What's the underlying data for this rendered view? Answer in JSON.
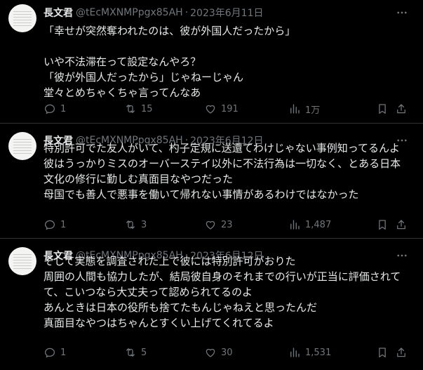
{
  "colors": {
    "background": "#000000",
    "text_primary": "#e7e9ea",
    "text_secondary": "#71767b",
    "divider": "#2f3336"
  },
  "icons": {
    "more": "more-horizontal-icon",
    "reply": "reply-icon",
    "retweet": "retweet-icon",
    "like": "heart-icon",
    "views": "views-chart-icon",
    "bookmark": "bookmark-icon",
    "share": "share-icon"
  },
  "tweets": [
    {
      "name": "長文君",
      "handle": "@tEcMXNMPpgx85AH",
      "separator": "·",
      "date": "2023年6月11日",
      "lines": [
        "「幸せが突然奪われたのは、彼が外国人だったから」",
        "",
        "いや不法滞在って設定なんやろ？",
        "「彼が外国人だったから」じゃねーじゃん",
        "堂々とめちゃくちゃ言ってんなあ"
      ],
      "replies": "1",
      "retweets": "15",
      "likes": "191",
      "views": "1万"
    },
    {
      "name": "長文君",
      "handle": "@tEcMXNMPpgx85AH",
      "separator": "·",
      "date": "2023年6月12日",
      "lines": [
        "特別許可でた友人がいて、杓子定規に送還てわけじゃない事例知ってるんよ",
        "彼はうっかりミスのオーバーステイ以外に不法行為は一切なく、とある日本",
        "文化の修行に勤しむ真面目なやつだった",
        "母国でも善人で悪事を働いて帰れない事情があるわけではなかった"
      ],
      "replies": "1",
      "retweets": "3",
      "likes": "23",
      "views": "1,487"
    },
    {
      "name": "長文君",
      "handle": "@tEcMXNMPpgx85AH",
      "separator": "·",
      "date": "2023年6月12日",
      "lines": [
        "そして実態を調査された上で彼には特別許可がおりた",
        "周囲の人間も協力したが、結局彼自身のそれまでの行いが正当に評価されて",
        "て、こいつなら大丈夫って認められてるのよ",
        "あんときは日本の役所も捨てたもんじゃねえと思ったんだ",
        "真面目なやつはちゃんとすくい上げてくれてるよ"
      ],
      "replies": "1",
      "retweets": "5",
      "likes": "30",
      "views": "1,531"
    }
  ]
}
